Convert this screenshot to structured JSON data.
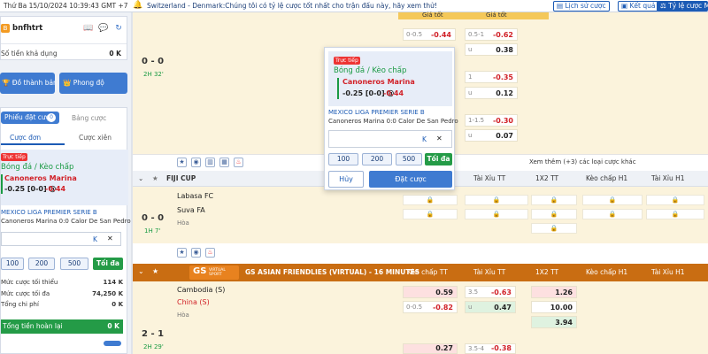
{
  "topbar": {
    "datetime": "Thứ Ba 15/10/2024 10:39:43 GMT +7",
    "ticker": "Switzerland - Denmark:Chúng tôi có tỷ lệ cược tốt nhất cho trận đấu này, hãy xem thử!",
    "history": "Lịch sử cược",
    "results": "Kết quả",
    "odds_type": "Tỷ lệ cược MA"
  },
  "user": {
    "badge": "B",
    "name": "bnfhtrt",
    "balance_label": "Số tiền khả dụng",
    "balance_value": "0 K"
  },
  "left_buttons": {
    "leaderboard": "Đồ thành bảng",
    "form": "Phong độ"
  },
  "betslip": {
    "tab_slip": "Phiếu đặt cược",
    "slip_count": "0",
    "tab_pending": "Bảng cược",
    "tab_single": "Cược đơn",
    "tab_parlay": "Cược xiên",
    "live": "Trực tiếp",
    "market": "Bóng đá / Kèo chấp",
    "team": "Canoneros Marina",
    "line": "-0.25 [0-0] @",
    "odd": "-0.44",
    "league": "MEXICO LIGA PREMIER SERIE B",
    "match": "Canoneros Marina 0:0  Calor De San Pedro",
    "k": "K",
    "close": "✕",
    "chips": [
      "100",
      "200",
      "500"
    ],
    "max": "Tối đa",
    "min_label": "Mức cược tối thiểu",
    "min_value": "114 K",
    "max_label": "Mức cược tối đa",
    "max_value": "74,250 K",
    "fee_label": "Tổng chi phí",
    "fee_value": "0 K",
    "refund_label": "Tổng tiền hoàn lại",
    "refund_value": "0 K"
  },
  "match1": {
    "score": "0 - 0",
    "time": "2H 32'",
    "hdr1": "Giá tốt",
    "hdr2": "Giá tốt",
    "rows": [
      {
        "h1": "0-0.5",
        "o1": "-0.44",
        "h2": "0.5-1",
        "o2": "-0.62"
      },
      {
        "h1": "",
        "o1": "",
        "h2": "u",
        "o2": "0.38"
      },
      {
        "h1": "",
        "o1": "",
        "h2": "1",
        "o2": "-0.35"
      },
      {
        "h1": "",
        "o1": "",
        "h2": "u",
        "o2": "0.12"
      },
      {
        "h1": "",
        "o1": "",
        "h2": "1-1.5",
        "o2": "-0.30"
      },
      {
        "h1": "",
        "o1": "",
        "h2": "u",
        "o2": "0.07"
      }
    ],
    "more": "Xem thêm (+3) các loại cược khác"
  },
  "popup": {
    "live": "Trực tiếp",
    "market": "Bóng đá / Kèo chấp",
    "team": "Canoneros Marina",
    "line": "-0.25 [0-0] @",
    "odd": "-0.44",
    "league": "MEXICO LIGA PREMIER SERIE B",
    "match": "Canoneros Marina 0:0  Calor De San Pedro",
    "k": "K",
    "close": "✕",
    "chips": [
      "100",
      "200",
      "500"
    ],
    "max": "Tối đa",
    "cancel": "Hủy",
    "place": "Đặt cược"
  },
  "fiji": {
    "league": "FIJI CUP",
    "headers": [
      "Tài Xỉu TT",
      "1X2 TT",
      "Kèo chấp H1",
      "Tài Xỉu H1"
    ],
    "home": "Labasa FC",
    "away": "Suva FA",
    "draw": "Hòa",
    "score": "0 - 0",
    "time": "1H 7'"
  },
  "gs": {
    "logo": "GS",
    "logo_sub": "VIRTUAL SPORT",
    "league": "GS ASIAN FRIENDLIES (VIRTUAL) - 16 MINUTES",
    "headers": [
      "Kèo chấp TT",
      "Tài Xỉu TT",
      "1X2 TT",
      "Kèo chấp H1",
      "Tài Xỉu H1"
    ],
    "home": "Cambodia (S)",
    "away": "China (S)",
    "draw": "Hòa",
    "score": "2 - 1",
    "time": "2H 29'",
    "hcp_home": "0.59",
    "hcp_away_line": "0-0.5",
    "hcp_away": "-0.82",
    "ou_line": "3.5",
    "ou_over": "-0.63",
    "ou_u": "u",
    "ou_under": "0.47",
    "x_home": "1.26",
    "x_away": "10.00",
    "x_draw": "3.94",
    "next_hcp": "0.27",
    "next_ou_line": "3.5-4",
    "next_ou": "-0.38"
  }
}
